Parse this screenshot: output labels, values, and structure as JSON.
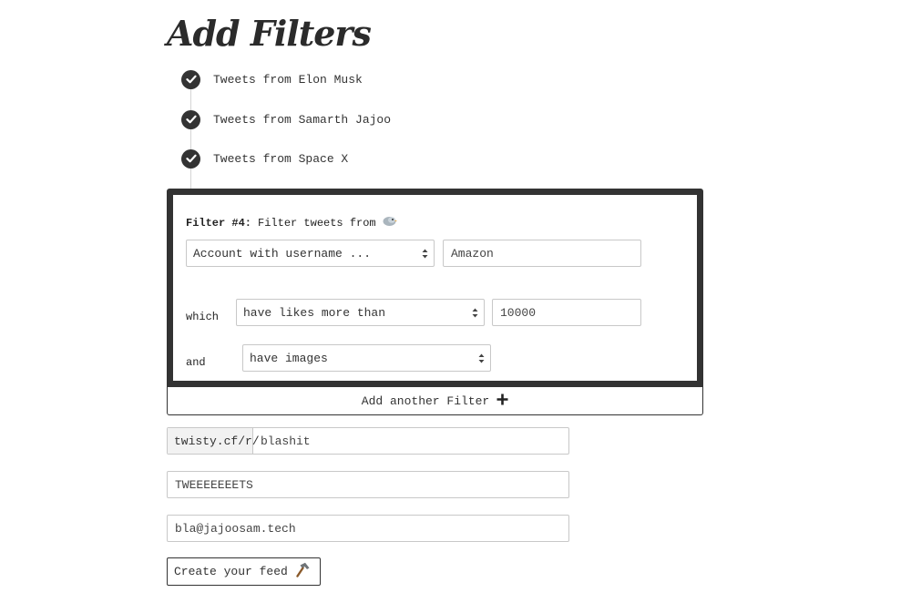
{
  "page": {
    "title": "Add Filters"
  },
  "completed_filters": [
    {
      "label": "Tweets from Elon Musk"
    },
    {
      "label": "Tweets from Samarth Jajoo"
    },
    {
      "label": "Tweets from Space X"
    }
  ],
  "current_filter": {
    "title_bold": "Filter #4:",
    "title_rest": "Filter tweets from",
    "source_select": "Account with username ...",
    "source_value": "Amazon",
    "which_label": "which",
    "condition_select": "have likes more than",
    "condition_value": "10000",
    "and_label": "and",
    "media_select": "have images"
  },
  "add_filter": {
    "label": "Add another Filter"
  },
  "feed_form": {
    "url_prefix": "twisty.cf/r/",
    "url_slug": "blashit",
    "feed_name": "TWEEEEEEETS",
    "email": "bla@jajoosam.tech"
  },
  "create_button": {
    "label": "Create your feed"
  },
  "colors": {
    "dark": "#333333",
    "border": "#c8c8c8",
    "addon_bg": "#f2f2f2"
  }
}
